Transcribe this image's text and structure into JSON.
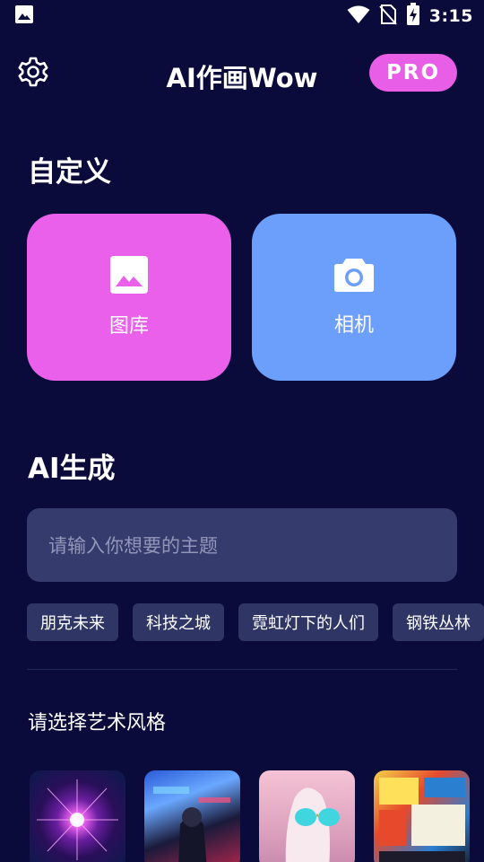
{
  "status_bar": {
    "time": "3:15",
    "icons": [
      "image-notification-icon",
      "wifi-icon",
      "no-sim-icon",
      "battery-charging-icon"
    ]
  },
  "header": {
    "title": "AI作画Wow",
    "pro_label": "PRO",
    "settings_icon": "gear-icon"
  },
  "custom_section": {
    "title": "自定义",
    "cards": [
      {
        "label": "图库",
        "icon": "gallery-icon",
        "color": "#ea60ea"
      },
      {
        "label": "相机",
        "icon": "camera-icon",
        "color": "#6b9ffb"
      }
    ]
  },
  "ai_section": {
    "title": "AI生成",
    "input_placeholder": "请输入你想要的主题",
    "suggestions": [
      "朋克未来",
      "科技之城",
      "霓虹灯下的人们",
      "钢铁丛林"
    ]
  },
  "style_section": {
    "title": "请选择艺术风格"
  },
  "colors": {
    "background": "#0b0b3b",
    "accent_pink": "#e95ee6",
    "accent_blue": "#6b9ffb",
    "input_bg": "#353b6d",
    "chip_bg": "#2f3564"
  }
}
